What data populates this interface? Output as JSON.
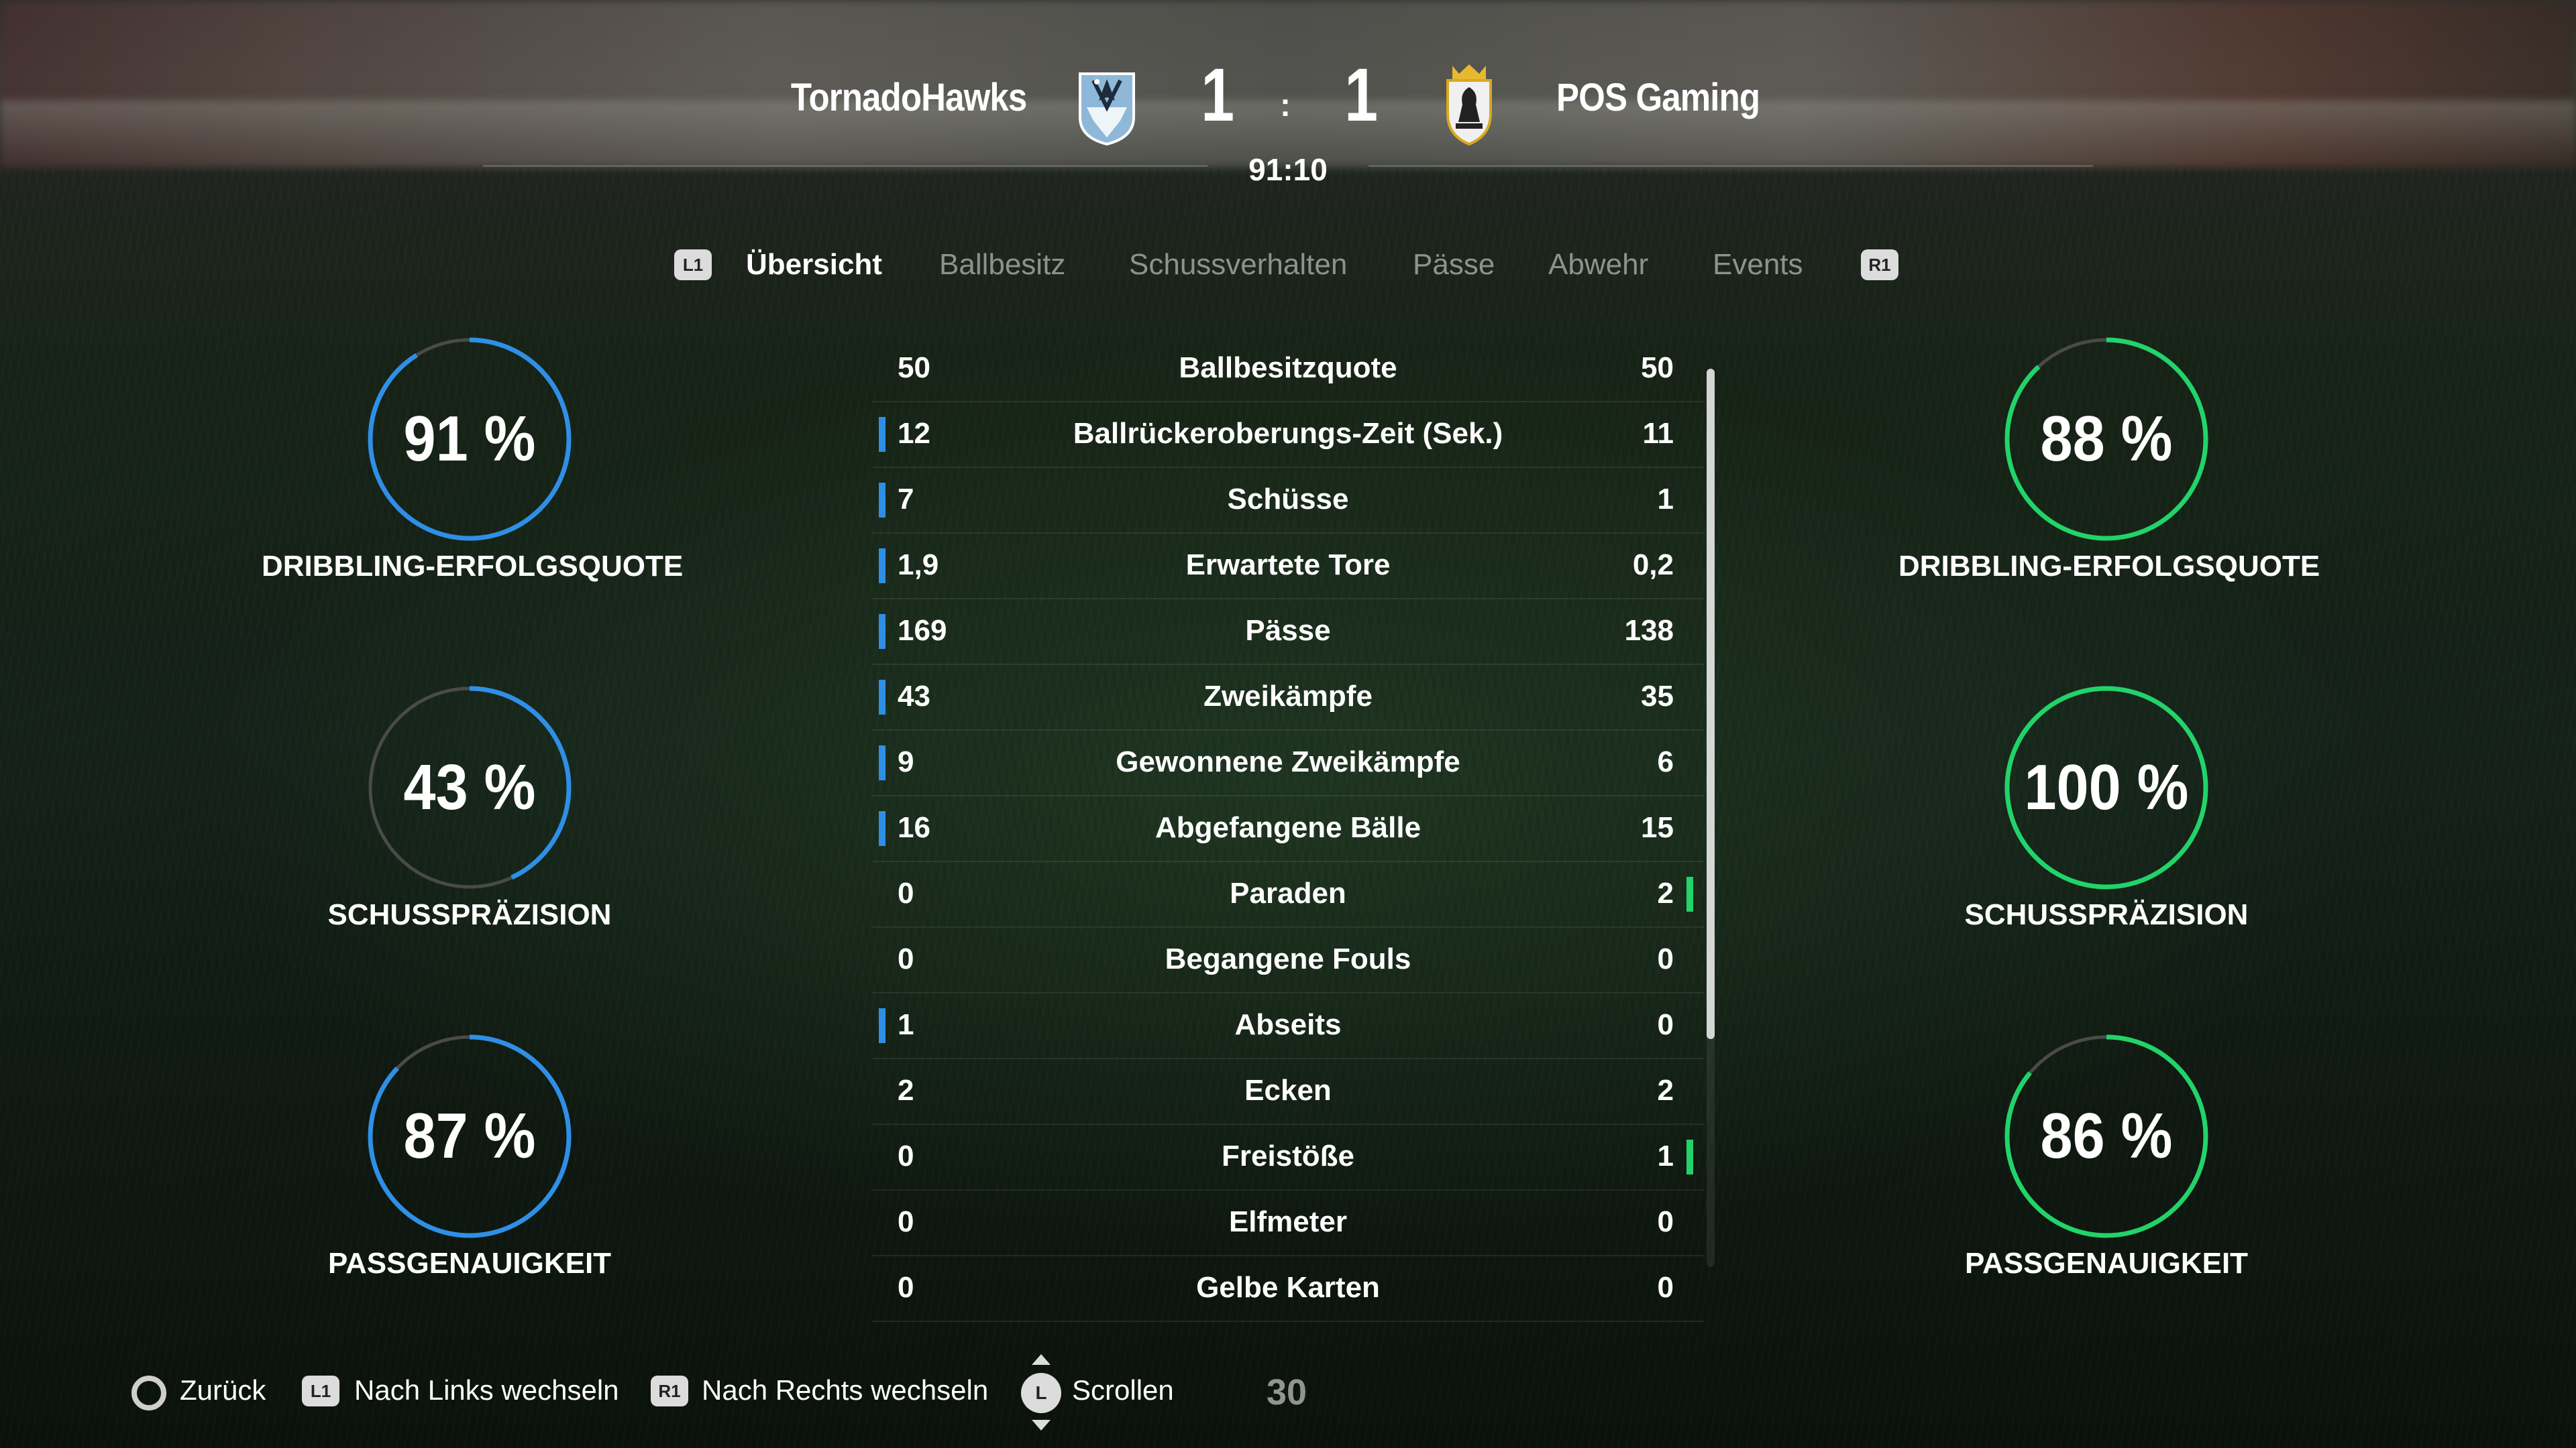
{
  "match": {
    "home_team": "TornadoHawks",
    "away_team": "POS Gaming",
    "home_score": "1",
    "away_score": "1",
    "separator": ":",
    "clock": "91:10"
  },
  "tabs": {
    "left_badge": "L1",
    "right_badge": "R1",
    "items": [
      {
        "label": "Übersicht",
        "active": true
      },
      {
        "label": "Ballbesitz",
        "active": false
      },
      {
        "label": "Schussverhalten",
        "active": false
      },
      {
        "label": "Pässe",
        "active": false
      },
      {
        "label": "Abwehr",
        "active": false
      },
      {
        "label": "Events",
        "active": false
      }
    ]
  },
  "home_rings": [
    {
      "value": "91 %",
      "percent": 91,
      "label": "DRIBBLING-ERFOLGSQUOTE"
    },
    {
      "value": "43 %",
      "percent": 43,
      "label": "SCHUSSPRÄZISION"
    },
    {
      "value": "87 %",
      "percent": 87,
      "label": "PASSGENAUIGKEIT"
    }
  ],
  "away_rings": [
    {
      "value": "88 %",
      "percent": 88,
      "label": "DRIBBLING-ERFOLGSQUOTE"
    },
    {
      "value": "100 %",
      "percent": 100,
      "label": "SCHUSSPRÄZISION"
    },
    {
      "value": "86 %",
      "percent": 86,
      "label": "PASSGENAUIGKEIT"
    }
  ],
  "colors": {
    "home_accent": "#2f8fe6",
    "away_accent": "#22d36a",
    "ring_track": "#4a4a4a"
  },
  "stats": [
    {
      "home": "50",
      "label": "Ballbesitzquote",
      "away": "50",
      "leader": "none"
    },
    {
      "home": "12",
      "label": "Ballrückeroberungs-Zeit (Sek.)",
      "away": "11",
      "leader": "home"
    },
    {
      "home": "7",
      "label": "Schüsse",
      "away": "1",
      "leader": "home"
    },
    {
      "home": "1,9",
      "label": "Erwartete Tore",
      "away": "0,2",
      "leader": "home"
    },
    {
      "home": "169",
      "label": "Pässe",
      "away": "138",
      "leader": "home"
    },
    {
      "home": "43",
      "label": "Zweikämpfe",
      "away": "35",
      "leader": "home"
    },
    {
      "home": "9",
      "label": "Gewonnene Zweikämpfe",
      "away": "6",
      "leader": "home"
    },
    {
      "home": "16",
      "label": "Abgefangene Bälle",
      "away": "15",
      "leader": "home"
    },
    {
      "home": "0",
      "label": "Paraden",
      "away": "2",
      "leader": "away"
    },
    {
      "home": "0",
      "label": "Begangene Fouls",
      "away": "0",
      "leader": "none"
    },
    {
      "home": "1",
      "label": "Abseits",
      "away": "0",
      "leader": "home"
    },
    {
      "home": "2",
      "label": "Ecken",
      "away": "2",
      "leader": "none"
    },
    {
      "home": "0",
      "label": "Freistöße",
      "away": "1",
      "leader": "away"
    },
    {
      "home": "0",
      "label": "Elfmeter",
      "away": "0",
      "leader": "none"
    },
    {
      "home": "0",
      "label": "Gelbe Karten",
      "away": "0",
      "leader": "none"
    }
  ],
  "footer": {
    "back_label": "Zurück",
    "left_badge": "L1",
    "left_label": "Nach Links wechseln",
    "right_badge": "R1",
    "right_label": "Nach Rechts wechseln",
    "stick_badge": "L",
    "scroll_label": "Scrollen",
    "page_number": "30"
  },
  "icons": {
    "home_crest": "minnesota-loon-crest-icon",
    "away_crest": "knight-shield-crown-crest-icon",
    "back_button": "circle-button-icon",
    "stick": "left-stick-icon"
  }
}
